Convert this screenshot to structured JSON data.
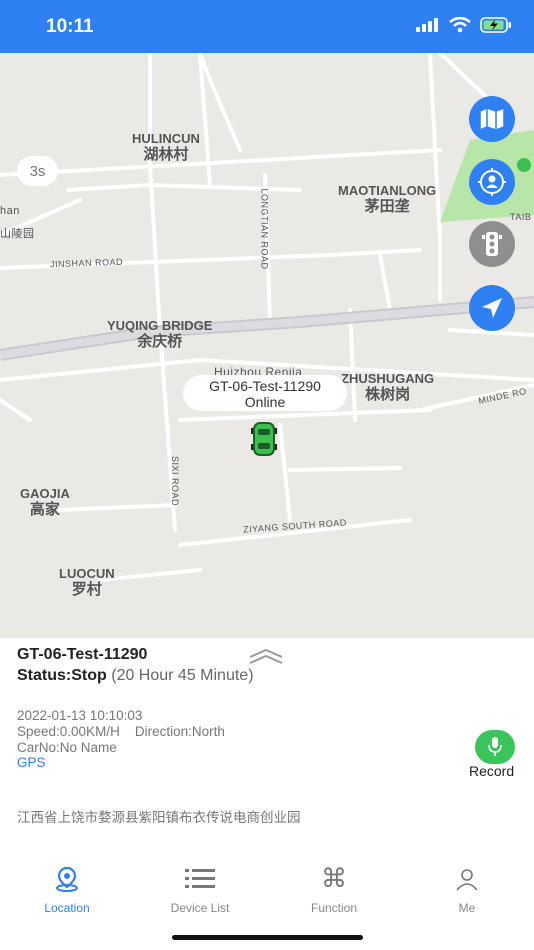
{
  "status_bar": {
    "time": "10:11"
  },
  "map": {
    "refresh_label": "3s",
    "places": [
      {
        "en": "HULINCUN",
        "cn": "湖林村"
      },
      {
        "en": "MAOTIANLONG",
        "cn": "茅田垄"
      },
      {
        "en": "YUQING BRIDGE",
        "cn": "余庆桥"
      },
      {
        "en": "ZHUSHUGANG",
        "cn": "株树岗"
      },
      {
        "en": "GAOJIA",
        "cn": "高家"
      },
      {
        "en": "LUOCUN",
        "cn": "罗村"
      }
    ],
    "roads": [
      "JINSHAN ROAD",
      "LONGTIAN ROAD",
      "SIXI ROAD",
      "ZIYANG SOUTH ROAD",
      "MINDE RO",
      "TAIB"
    ],
    "edge_labels": [
      "han",
      "山陵园"
    ],
    "poi": "Huizhou Renjia",
    "marker": {
      "name": "GT-06-Test-11290",
      "state": "Online"
    }
  },
  "device": {
    "name": "GT-06-Test-11290",
    "status_label": "Status:Stop",
    "status_duration": "(20 Hour 45 Minute)",
    "time": "2022-01-13 10:10:03",
    "speed": "Speed:0.00KM/H",
    "direction": "Direction:North",
    "car_no": "CarNo:No Name",
    "source": "GPS",
    "record_label": "Record",
    "address": "江西省上饶市婺源县紫阳镇布衣传说电商创业园"
  },
  "tabs": [
    {
      "label": "Location",
      "active": true
    },
    {
      "label": "Device List",
      "active": false
    },
    {
      "label": "Function",
      "active": false
    },
    {
      "label": "Me",
      "active": false
    }
  ],
  "colors": {
    "accent": "#2f80f2",
    "record_green": "#3bc45a",
    "car_green": "#3bbf4e",
    "park_green": "#b8e6a8"
  }
}
